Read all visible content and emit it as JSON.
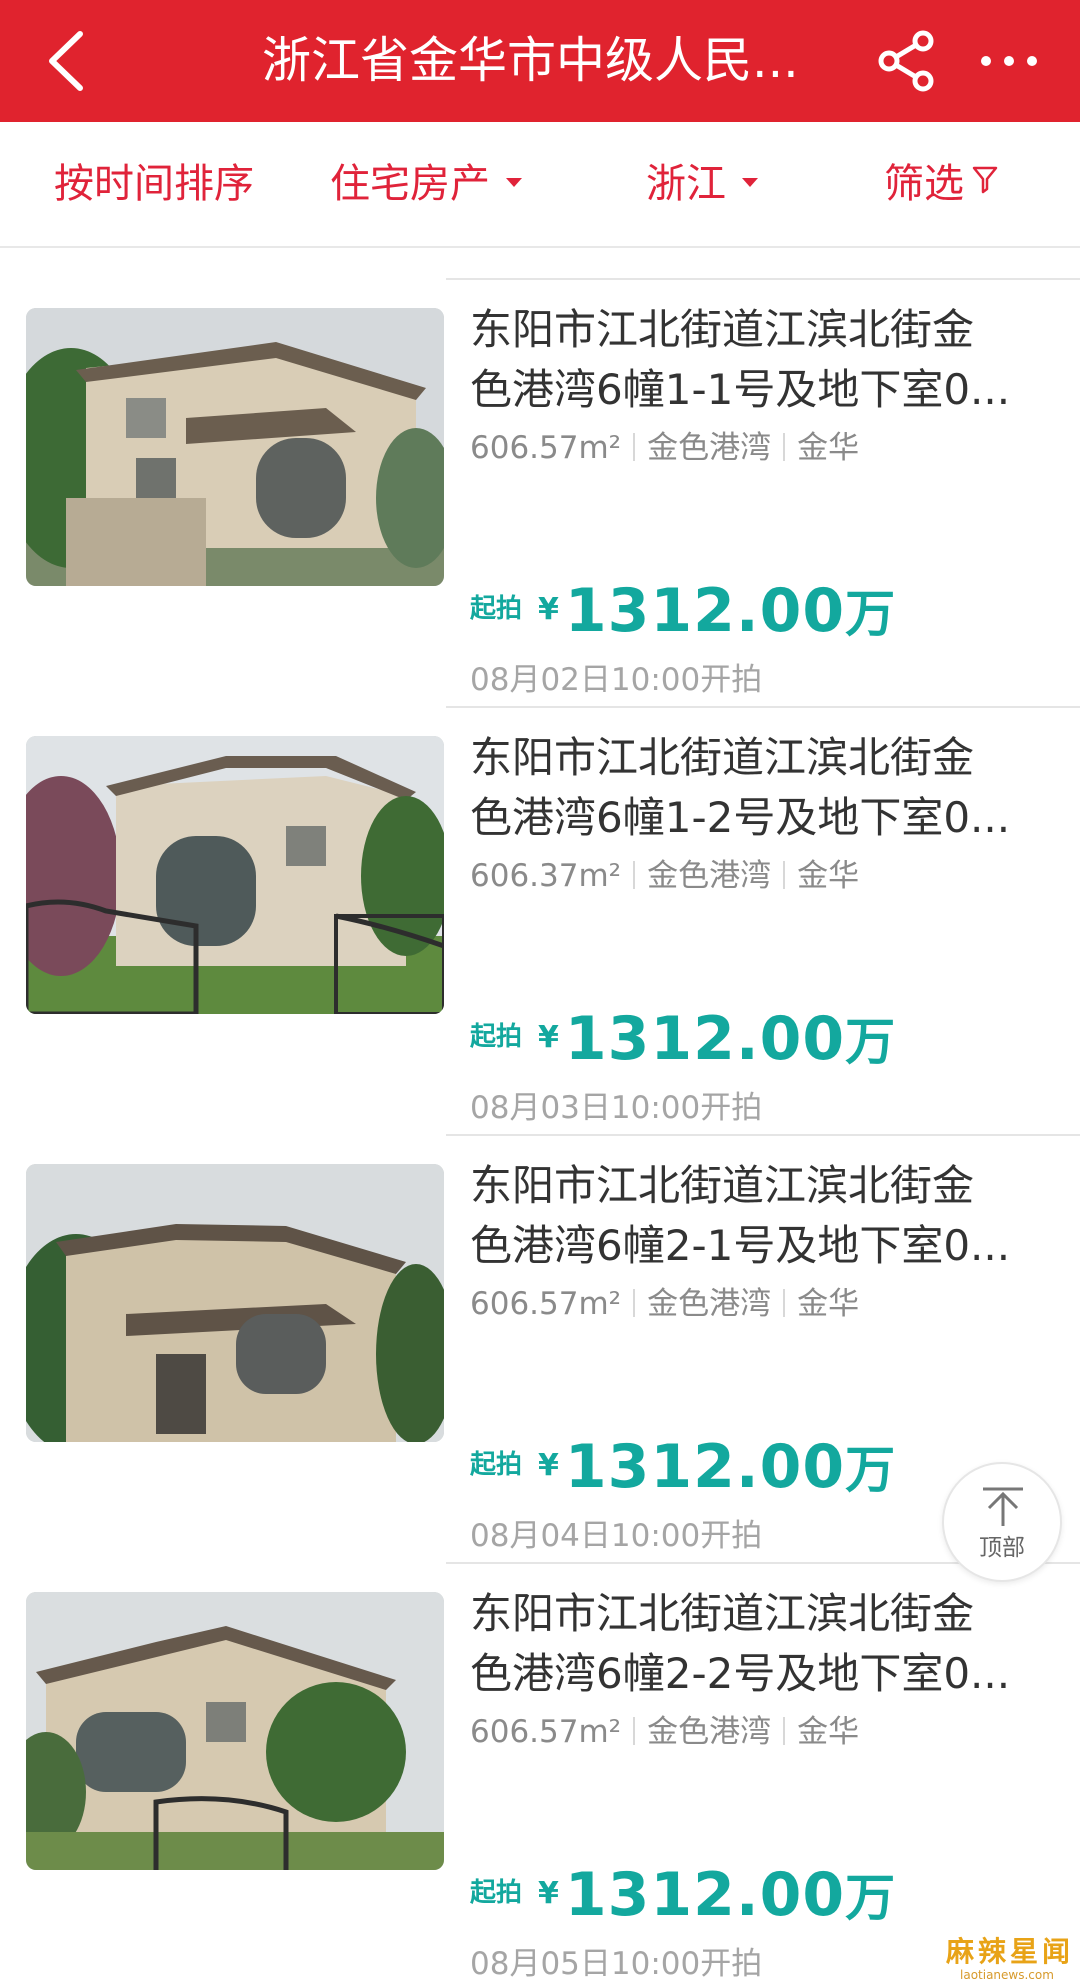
{
  "header": {
    "title": "浙江省金华市中级人民...",
    "back_icon": "chevron-left-icon",
    "share_icon": "share-icon",
    "more_icon": "more-dots-icon",
    "color": "#e0232e"
  },
  "filters": [
    {
      "label": "按时间排序"
    },
    {
      "label": "住宅房产"
    },
    {
      "label": "浙江"
    },
    {
      "label": "筛选"
    }
  ],
  "items": [
    {
      "title_line1": "东阳市江北街道江滨北街金",
      "title_line2": "色港湾6幢1-1号及地下室0...",
      "area": "606.57m²",
      "community": "金色港湾",
      "city": "金华",
      "price_label": "起拍",
      "currency": "¥",
      "price": "1312.00",
      "unit": "万",
      "time": "08月02日10:00开拍"
    },
    {
      "title_line1": "东阳市江北街道江滨北街金",
      "title_line2": "色港湾6幢1-2号及地下室0...",
      "area": "606.37m²",
      "community": "金色港湾",
      "city": "金华",
      "price_label": "起拍",
      "currency": "¥",
      "price": "1312.00",
      "unit": "万",
      "time": "08月03日10:00开拍"
    },
    {
      "title_line1": "东阳市江北街道江滨北街金",
      "title_line2": "色港湾6幢2-1号及地下室0...",
      "area": "606.57m²",
      "community": "金色港湾",
      "city": "金华",
      "price_label": "起拍",
      "currency": "¥",
      "price": "1312.00",
      "unit": "万",
      "time": "08月04日10:00开拍"
    },
    {
      "title_line1": "东阳市江北街道江滨北街金",
      "title_line2": "色港湾6幢2-2号及地下室0...",
      "area": "606.57m²",
      "community": "金色港湾",
      "city": "金华",
      "price_label": "起拍",
      "currency": "¥",
      "price": "1312.00",
      "unit": "万",
      "time": "08月05日10:00开拍"
    }
  ],
  "back_to_top": {
    "label": "顶部"
  },
  "watermark": {
    "cn": "麻辣星闻",
    "en": "laotianews.com"
  },
  "colors": {
    "accent": "#e0233a",
    "price": "#13a89e"
  }
}
